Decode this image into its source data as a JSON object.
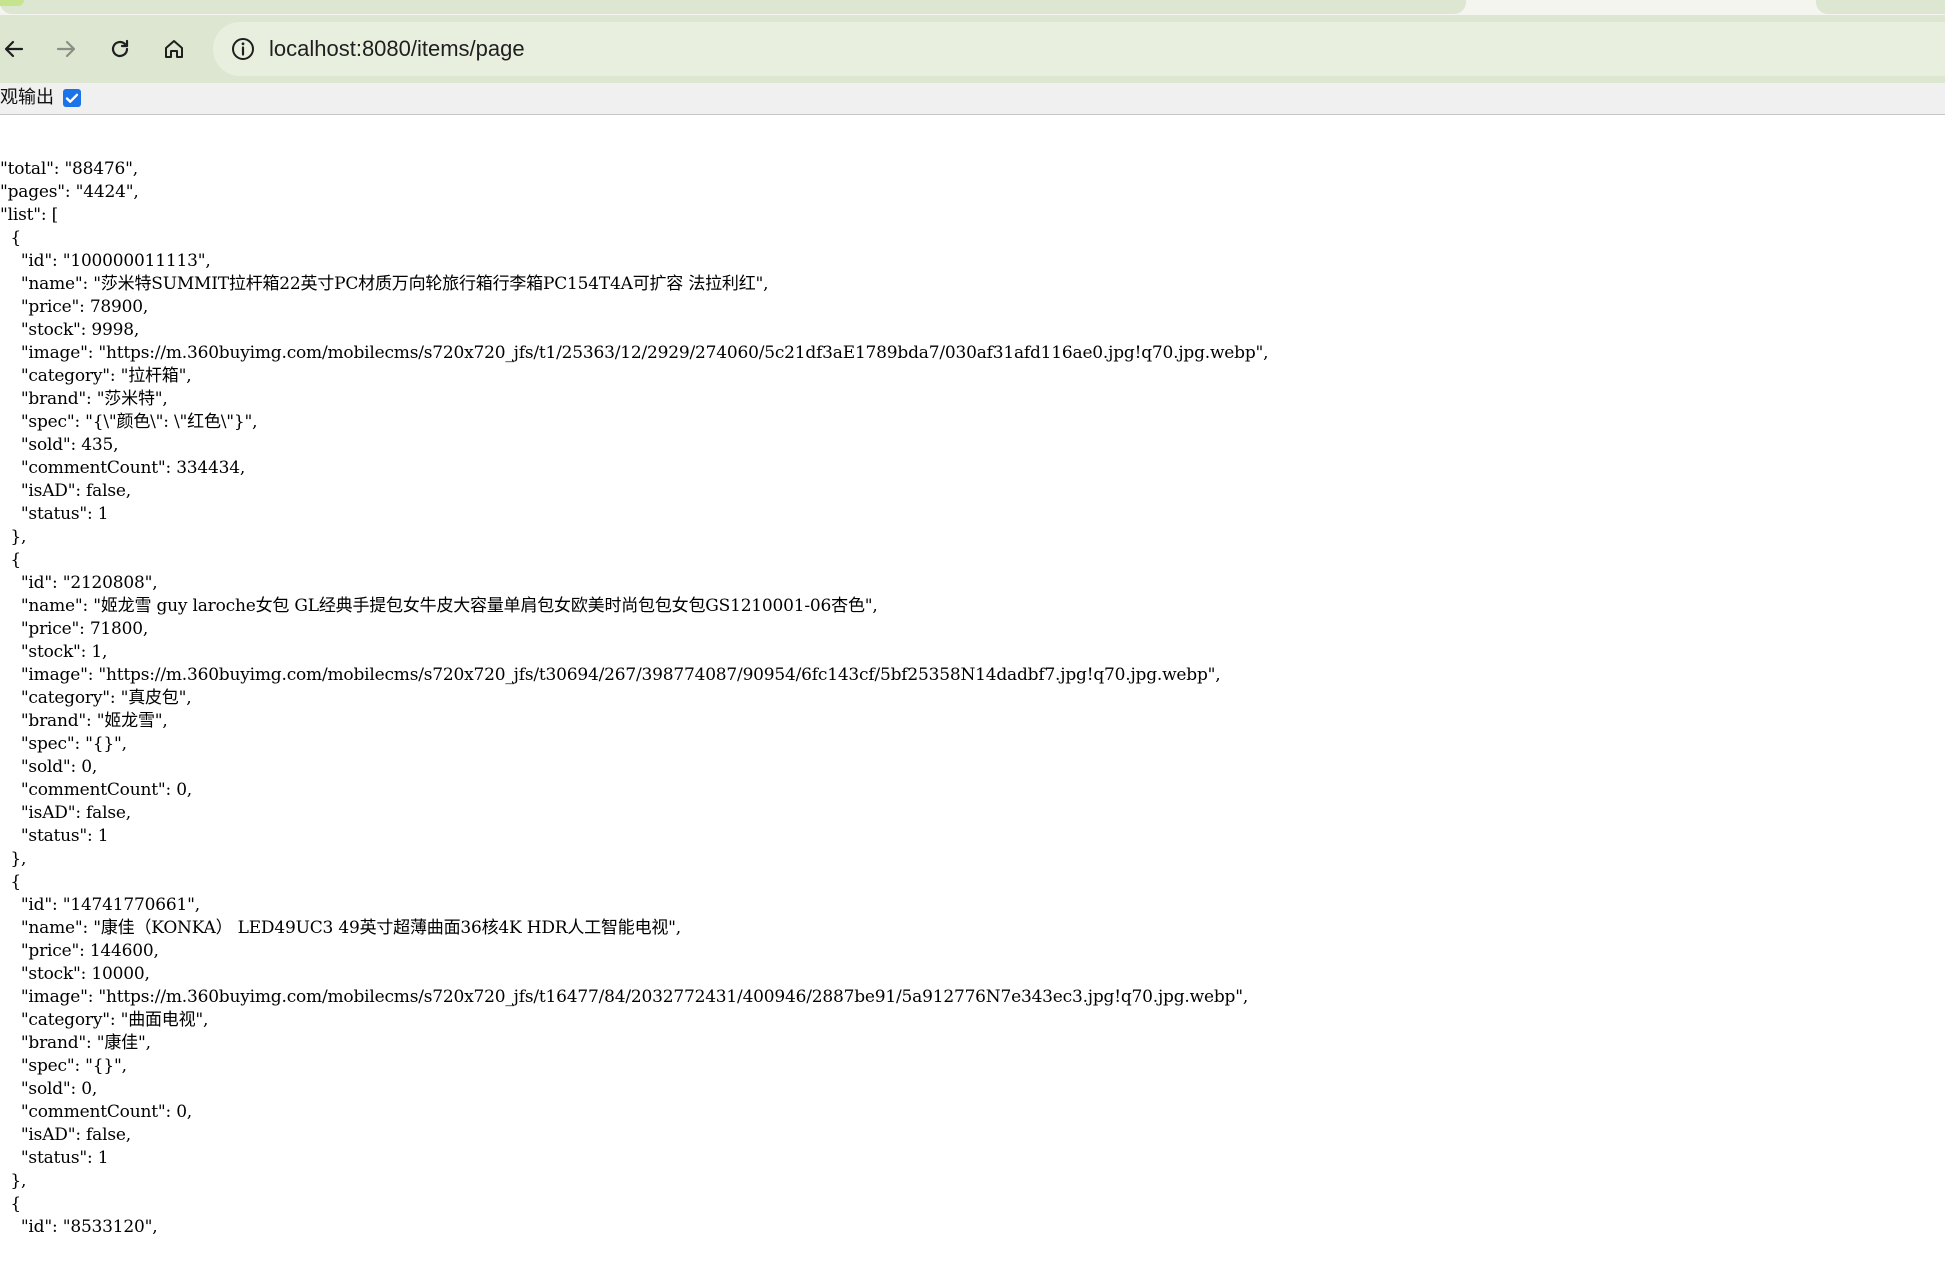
{
  "browser": {
    "url": "localhost:8080/items/page"
  },
  "viewer": {
    "label": "观输出",
    "checked": true
  },
  "json_lines": [
    "\"total\": \"88476\",",
    "\"pages\": \"4424\",",
    "\"list\": [",
    "  {",
    "    \"id\": \"100000011113\",",
    "    \"name\": \"莎米特SUMMIT拉杆箱22英寸PC材质万向轮旅行箱行李箱PC154T4A可扩容 法拉利红\",",
    "    \"price\": 78900,",
    "    \"stock\": 9998,",
    "    \"image\": \"https://m.360buyimg.com/mobilecms/s720x720_jfs/t1/25363/12/2929/274060/5c21df3aE1789bda7/030af31afd116ae0.jpg!q70.jpg.webp\",",
    "    \"category\": \"拉杆箱\",",
    "    \"brand\": \"莎米特\",",
    "    \"spec\": \"{\\\"颜色\\\": \\\"红色\\\"}\",",
    "    \"sold\": 435,",
    "    \"commentCount\": 334434,",
    "    \"isAD\": false,",
    "    \"status\": 1",
    "  },",
    "  {",
    "    \"id\": \"2120808\",",
    "    \"name\": \"姬龙雪 guy laroche女包 GL经典手提包女牛皮大容量单肩包女欧美时尚包包女包GS1210001-06杏色\",",
    "    \"price\": 71800,",
    "    \"stock\": 1,",
    "    \"image\": \"https://m.360buyimg.com/mobilecms/s720x720_jfs/t30694/267/398774087/90954/6fc143cf/5bf25358N14dadbf7.jpg!q70.jpg.webp\",",
    "    \"category\": \"真皮包\",",
    "    \"brand\": \"姬龙雪\",",
    "    \"spec\": \"{}\",",
    "    \"sold\": 0,",
    "    \"commentCount\": 0,",
    "    \"isAD\": false,",
    "    \"status\": 1",
    "  },",
    "  {",
    "    \"id\": \"14741770661\",",
    "    \"name\": \"康佳（KONKA） LED49UC3 49英寸超薄曲面36核4K HDR人工智能电视\",",
    "    \"price\": 144600,",
    "    \"stock\": 10000,",
    "    \"image\": \"https://m.360buyimg.com/mobilecms/s720x720_jfs/t16477/84/2032772431/400946/2887be91/5a912776N7e343ec3.jpg!q70.jpg.webp\",",
    "    \"category\": \"曲面电视\",",
    "    \"brand\": \"康佳\",",
    "    \"spec\": \"{}\",",
    "    \"sold\": 0,",
    "    \"commentCount\": 0,",
    "    \"isAD\": false,",
    "    \"status\": 1",
    "  },",
    "  {",
    "    \"id\": \"8533120\","
  ]
}
